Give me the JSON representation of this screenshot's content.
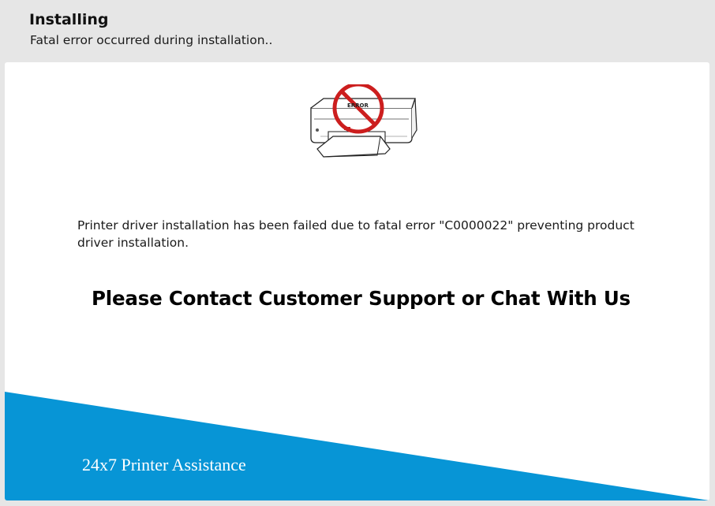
{
  "header": {
    "title": "Installing",
    "subtitle": "Fatal error occurred during installation.."
  },
  "illustration": {
    "icon": "printer-error-icon",
    "label": "ERROR",
    "prohibition_color": "#cc1e1e"
  },
  "content": {
    "message": "Printer driver installation has been failed due to fatal error \"C0000022\" preventing product driver installation.",
    "call_to_action": "Please Contact Customer Support or Chat With Us"
  },
  "footer": {
    "brand": "24x7 Printer Assistance",
    "banner_color": "#0795d6"
  }
}
